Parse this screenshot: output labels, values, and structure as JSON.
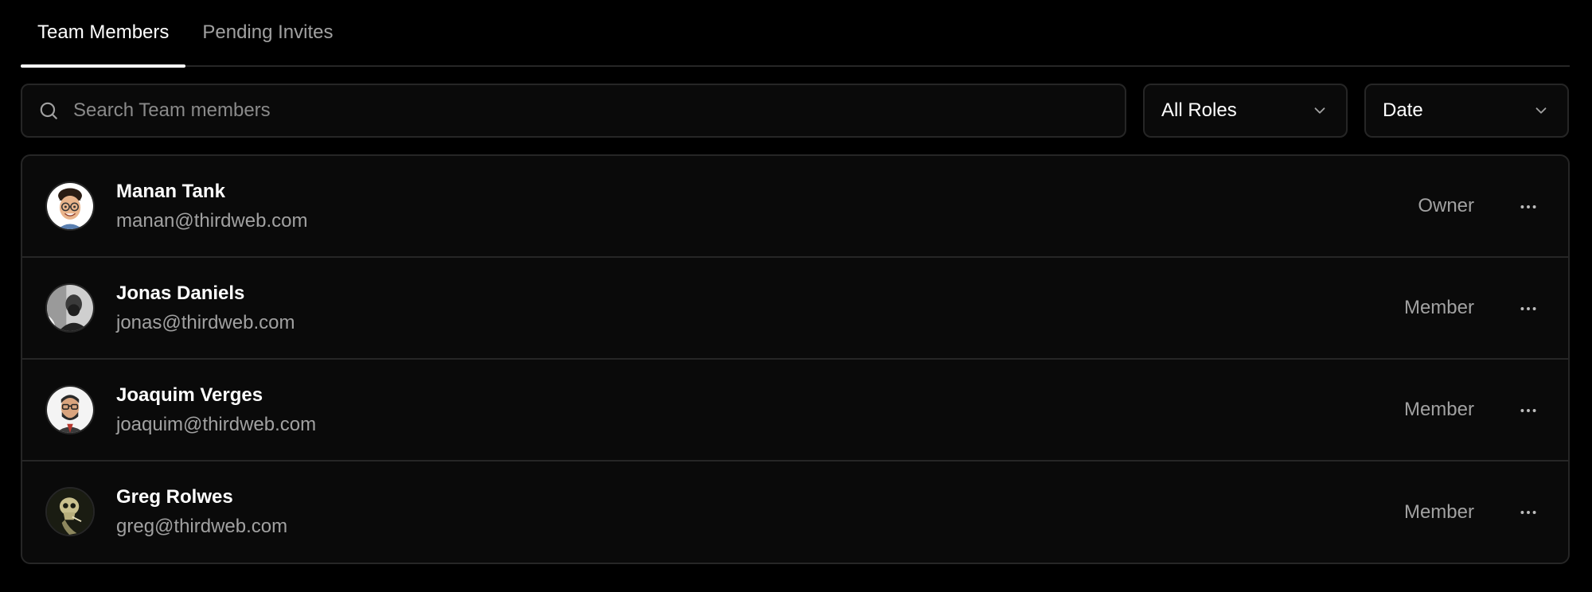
{
  "tabs": [
    {
      "label": "Team Members",
      "active": true
    },
    {
      "label": "Pending Invites",
      "active": false
    }
  ],
  "search": {
    "placeholder": "Search Team members",
    "value": ""
  },
  "filters": {
    "role": {
      "selected": "All Roles"
    },
    "sort": {
      "selected": "Date"
    }
  },
  "members": [
    {
      "name": "Manan Tank",
      "email": "manan@thirdweb.com",
      "role": "Owner",
      "avatar_icon": "memoji-avatar"
    },
    {
      "name": "Jonas Daniels",
      "email": "jonas@thirdweb.com",
      "role": "Member",
      "avatar_icon": "bw-photo-avatar"
    },
    {
      "name": "Joaquim Verges",
      "email": "joaquim@thirdweb.com",
      "role": "Member",
      "avatar_icon": "illustrated-avatar"
    },
    {
      "name": "Greg Rolwes",
      "email": "greg@thirdweb.com",
      "role": "Member",
      "avatar_icon": "skull-painting-avatar"
    }
  ],
  "colors": {
    "background": "#000000",
    "surface": "#0a0a0a",
    "border": "#262626",
    "text_primary": "#ffffff",
    "text_muted": "#a1a1a1"
  }
}
